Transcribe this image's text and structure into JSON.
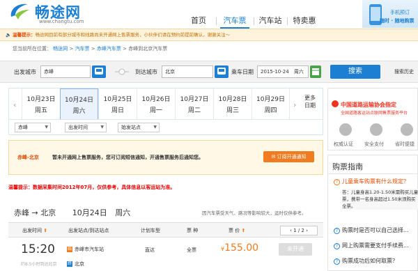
{
  "header": {
    "logo_text": "畅途网",
    "logo_url": "www.changtu.com",
    "nav": [
      "首页",
      "汽车票",
      "汽车站",
      "特卖惠"
    ],
    "active_nav": "汽车票",
    "promo_line1": "手机预订",
    "promo_line2": "随时 · 随地购票"
  },
  "notice": {
    "label": "温馨提示：",
    "text": "畅途网目前有部分城市和线路尚未开通网上售票服务，小伙伴们请在预约前提前确认，谢谢关注～"
  },
  "breadcrumb": {
    "prefix": "您当前所在位置：",
    "items": [
      "畅途网",
      "汽车票",
      "赤峰汽车票"
    ],
    "current": "赤峰到北京汽车票"
  },
  "search": {
    "from_label": "出发城市",
    "from_value": "赤峰",
    "to_label": "到达城市",
    "to_value": "北京",
    "date_label": "乘车日期",
    "date_value": "2015-10-24",
    "weekday": "周六",
    "button": "搜索",
    "history": "搜索历史"
  },
  "dates": [
    {
      "date": "10月23日",
      "week": "周五"
    },
    {
      "date": "10月24日",
      "week": "周六"
    },
    {
      "date": "10月25日",
      "week": "周日"
    },
    {
      "date": "10月26日",
      "week": "周一"
    },
    {
      "date": "10月27日",
      "week": "周二"
    },
    {
      "date": "10月28日",
      "week": "周三"
    },
    {
      "date": "10月29日",
      "week": "周四"
    }
  ],
  "selected_date_index": 1,
  "more_dates": {
    "line1": "更多",
    "line2": "日期"
  },
  "filters": {
    "city": "赤峰",
    "time": "出发时间",
    "station": "始发站点"
  },
  "no_service": {
    "route": "赤峰-北京",
    "text": "暂未开通网上售票服务，您可订阅短信通知，开通售票服务后通知您。",
    "button": "订阅开通通知"
  },
  "warning": {
    "label": "温馨提示：",
    "text": "数据采集时间2012年07月，仅供参考，具体信息以客运站为准。"
  },
  "route": {
    "from": "赤峰",
    "arrow": "→",
    "to": "北京",
    "date": "10月24日",
    "week": "周六",
    "tips": "因汽车票受天气、路况等影响较大，运时仅供参考。"
  },
  "table": {
    "headers": [
      "出发时间",
      "出发站点/到达站点",
      "计划车型",
      "票 种",
      "票 价"
    ],
    "pager": "1 / 2",
    "rows": [
      {
        "time": "15:20",
        "hint": "约8.5小时到达北京",
        "from_tag": "始",
        "from_station": "赤峰市汽车站",
        "to_tag": "终",
        "to_station": "北京",
        "bus_type": "直达",
        "ticket_type": "全票",
        "currency": "¥",
        "price": "155.00",
        "action": "未开通"
      }
    ]
  },
  "sidebar": {
    "assoc_title": "中国道路运输协会指定",
    "assoc_sub": "全国道路客运站点联网售票服务平台",
    "icons": [
      {
        "icon": "verified-icon",
        "label": "权威认证"
      },
      {
        "icon": "shield-icon",
        "label": "安全支付"
      },
      {
        "icon": "clock-icon",
        "label": "省时便捷"
      }
    ],
    "guide_title": "购票指南",
    "questions": [
      {
        "text": "儿童乘车购票有什么规定？",
        "hot": true
      },
      {
        "text": "购票时是否可以自己选择...",
        "hot": false
      },
      {
        "text": "网上购票需要支付手续费...",
        "hot": false
      },
      {
        "text": "购票成功后如何取票？",
        "hot": false
      }
    ],
    "answer": "答：儿童身高1.20-1.50米需购买儿童票，携带一名身高超过1.50米须购买全票。"
  },
  "colors": {
    "brand": "#1c7fd1",
    "accent": "#f07b20",
    "alert": "#e24b00"
  }
}
